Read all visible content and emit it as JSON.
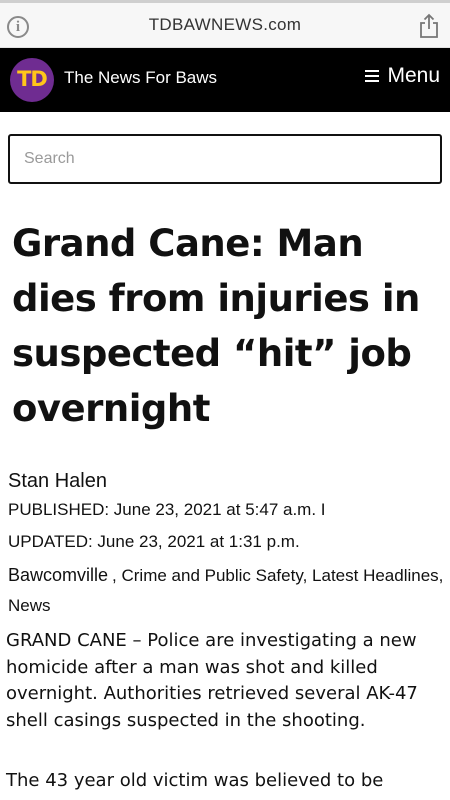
{
  "browser": {
    "url": "TDBAWNEWS.com",
    "info_icon": "info-icon",
    "share_icon": "share-icon"
  },
  "header": {
    "logo_text": "TD",
    "tagline": "The News For Baws",
    "menu_label": "Menu",
    "colors": {
      "background": "#000000",
      "logo_circle": "#6f2c91",
      "logo_letters": "#ffc61a"
    }
  },
  "search": {
    "placeholder": "Search",
    "value": ""
  },
  "article": {
    "headline": "Grand Cane: Man dies from injuries in suspected “hit” job overnight",
    "author": "Stan Halen",
    "published": "PUBLISHED: June 23, 2021 at 5:47 a.m.  I",
    "updated": "UPDATED: June 23, 2021 at  1:31 p.m.",
    "categories": [
      "Bawcomville",
      ", Crime and Public Safety, ",
      "Latest Headlines",
      ", ",
      "News"
    ],
    "paragraphs": [
      "GRAND CANE – Police are investigating a new homicide after a man was shot and killed overnight. Authorities retrieved several AK-47 shell casings suspected in the shooting.",
      "The 43 year old victim was believed to be"
    ]
  }
}
